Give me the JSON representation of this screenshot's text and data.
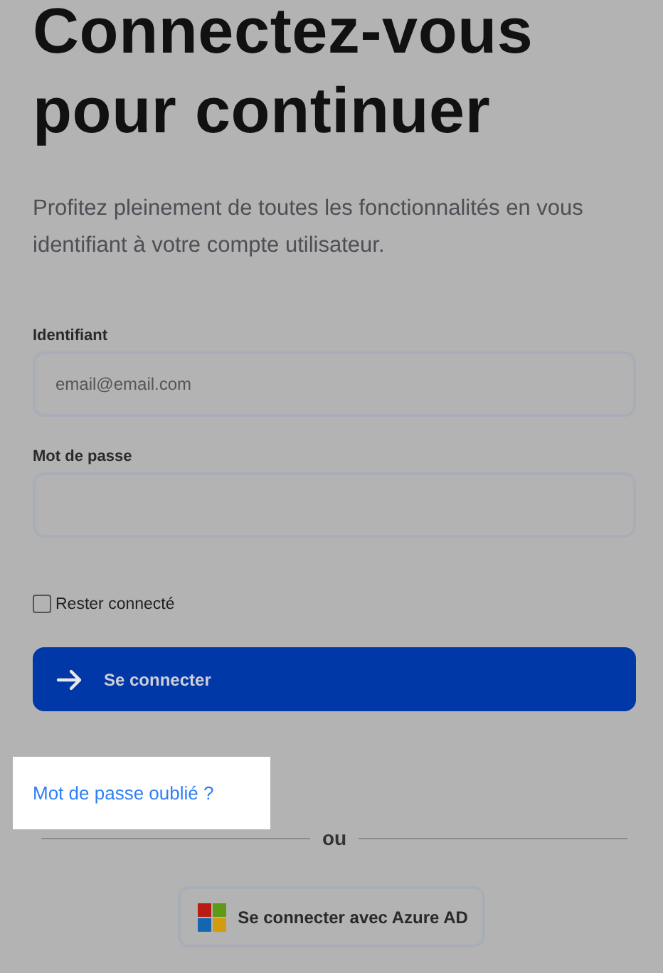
{
  "heading": "Connectez-vous pour continuer",
  "intro": "Profitez pleinement de toutes les fonctionnalités en vous identifiant à votre compte utilisateur.",
  "fields": [
    {
      "label": "Identifiant",
      "placeholder": "email@email.com"
    },
    {
      "label": "Mot de passe"
    }
  ],
  "remember": {
    "label": "Rester connecté",
    "checked": false
  },
  "submit": "Se connecter",
  "forgot_link": {
    "label": "Mot de passe oublié ?",
    "highlighted": true
  },
  "separator": "ou",
  "sso_button": "Se connecter avec Azure AD"
}
